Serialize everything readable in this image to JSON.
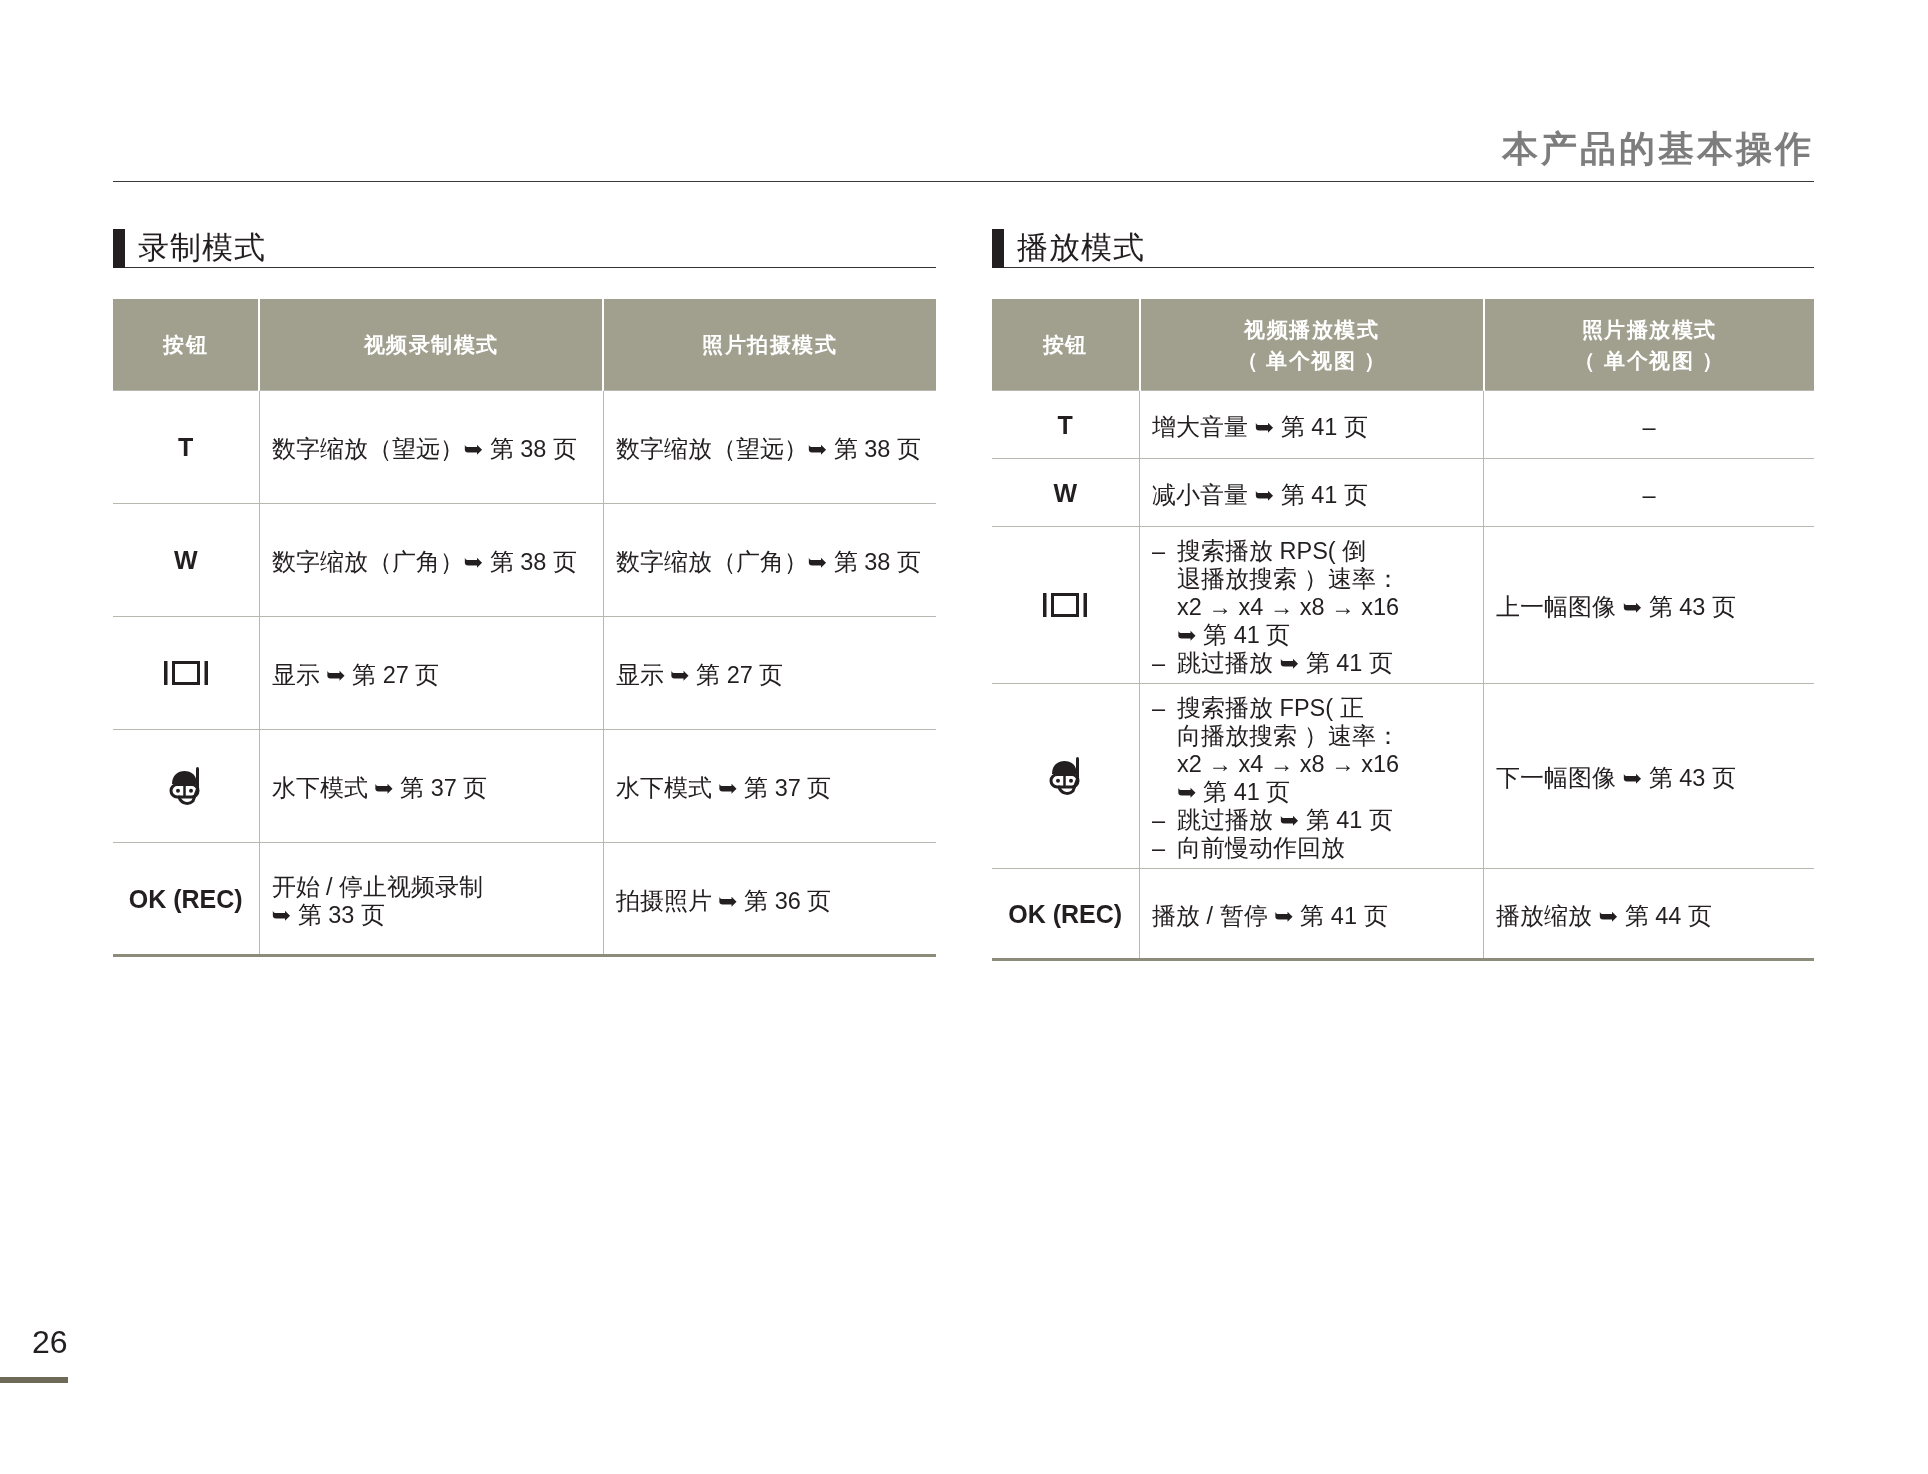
{
  "page_header": {
    "title": "本产品的基本操作"
  },
  "sections": [
    {
      "title": "录制模式",
      "columns": [
        {
          "lines": [
            "按钮"
          ]
        },
        {
          "lines": [
            "视频录制模式"
          ]
        },
        {
          "lines": [
            "照片拍摄模式"
          ]
        }
      ],
      "rows": [
        {
          "cells": [
            {
              "kind": "label",
              "text": "T"
            },
            {
              "kind": "text",
              "lines": [
                "数字缩放（望远）➥ 第 38 页"
              ]
            },
            {
              "kind": "text",
              "lines": [
                "数字缩放（望远）➥ 第 38 页"
              ]
            }
          ]
        },
        {
          "cells": [
            {
              "kind": "label",
              "text": "W"
            },
            {
              "kind": "text",
              "lines": [
                "数字缩放（广角）➥ 第 38 页"
              ]
            },
            {
              "kind": "text",
              "lines": [
                "数字缩放（广角）➥ 第 38 页"
              ]
            }
          ]
        },
        {
          "cells": [
            {
              "kind": "display"
            },
            {
              "kind": "text",
              "lines": [
                "显示 ➥ 第 27 页"
              ]
            },
            {
              "kind": "text",
              "lines": [
                "显示 ➥ 第 27 页"
              ]
            }
          ]
        },
        {
          "cells": [
            {
              "kind": "underwater"
            },
            {
              "kind": "text",
              "lines": [
                "水下模式 ➥ 第 37 页"
              ]
            },
            {
              "kind": "text",
              "lines": [
                "水下模式 ➥ 第 37 页"
              ]
            }
          ]
        },
        {
          "cells": [
            {
              "kind": "label",
              "text": "OK (REC)"
            },
            {
              "kind": "text",
              "lines": [
                "开始 / 停止视频录制",
                "➥ 第 33 页"
              ]
            },
            {
              "kind": "text",
              "lines": [
                "拍摄照片 ➥ 第 36 页"
              ]
            }
          ]
        }
      ]
    },
    {
      "title": "播放模式",
      "columns": [
        {
          "lines": [
            "按钮"
          ]
        },
        {
          "lines": [
            "视频播放模式",
            "（ 单个视图 ）"
          ]
        },
        {
          "lines": [
            "照片播放模式",
            "（ 单个视图 ）"
          ]
        }
      ],
      "rows": [
        {
          "cells": [
            {
              "kind": "label",
              "text": "T"
            },
            {
              "kind": "text",
              "lines": [
                "增大音量 ➥ 第 41 页"
              ]
            },
            {
              "kind": "dash",
              "text": "–"
            }
          ]
        },
        {
          "cells": [
            {
              "kind": "label",
              "text": "W"
            },
            {
              "kind": "text",
              "lines": [
                "减小音量 ➥ 第 41 页"
              ]
            },
            {
              "kind": "dash",
              "text": "–"
            }
          ]
        },
        {
          "cells": [
            {
              "kind": "display"
            },
            {
              "kind": "list",
              "items": [
                {
                  "marker": "–",
                  "lines": [
                    "搜索播放 RPS( 倒",
                    "退播放搜索 ）速率：",
                    "x2 → x4 → x8 → x16",
                    "➥ 第 41 页"
                  ]
                },
                {
                  "marker": "–",
                  "lines": [
                    "跳过播放 ➥ 第 41 页"
                  ]
                }
              ]
            },
            {
              "kind": "text",
              "lines": [
                "上一幅图像 ➥ 第 43 页"
              ]
            }
          ]
        },
        {
          "cells": [
            {
              "kind": "underwater"
            },
            {
              "kind": "list",
              "items": [
                {
                  "marker": "–",
                  "lines": [
                    "搜索播放 FPS( 正",
                    "向播放搜索 ）速率：",
                    "x2 → x4 → x8 → x16",
                    "➥ 第 41 页"
                  ]
                },
                {
                  "marker": "–",
                  "lines": [
                    "跳过播放 ➥ 第 41 页"
                  ]
                },
                {
                  "marker": "–",
                  "lines": [
                    "向前慢动作回放"
                  ]
                }
              ]
            },
            {
              "kind": "text",
              "lines": [
                "下一幅图像 ➥ 第 43 页"
              ]
            }
          ]
        },
        {
          "cells": [
            {
              "kind": "label",
              "text": "OK (REC)"
            },
            {
              "kind": "text",
              "lines": [
                "播放 / 暂停 ➥ 第 41 页"
              ]
            },
            {
              "kind": "text",
              "lines": [
                "播放缩放 ➥ 第 44 页"
              ]
            }
          ]
        }
      ]
    }
  ],
  "page_number": "26"
}
